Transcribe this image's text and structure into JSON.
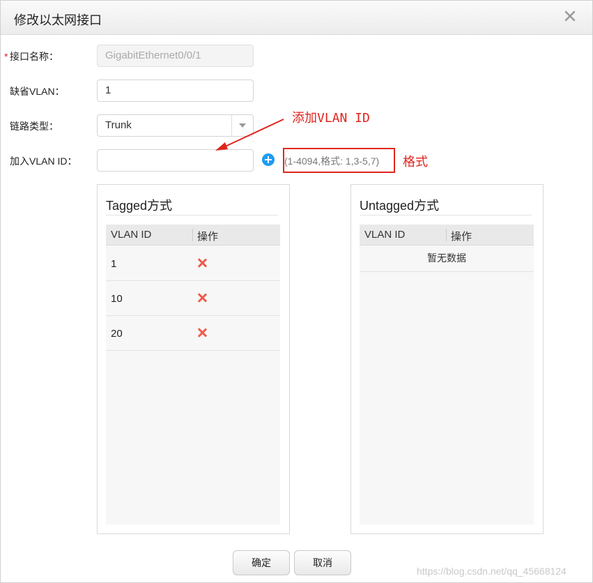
{
  "dialog": {
    "title": "修改以太网接口"
  },
  "form": {
    "interface_name": {
      "label": "接口名称：",
      "required_mark": "*",
      "value": "GigabitEthernet0/0/1"
    },
    "default_vlan": {
      "label": "缺省VLAN：",
      "value": "1"
    },
    "link_type": {
      "label": "链路类型：",
      "value": "Trunk"
    },
    "add_vlan": {
      "label": "加入VLAN ID：",
      "value": "",
      "hint": "(1-4094,格式: 1,3-5,7)"
    }
  },
  "annotations": {
    "add_vlan_id": "添加VLAN ID",
    "format": "格式"
  },
  "tagged": {
    "title": "Tagged方式",
    "columns": [
      "VLAN ID",
      "操作"
    ],
    "rows": [
      "1",
      "10",
      "20"
    ]
  },
  "untagged": {
    "title": "Untagged方式",
    "columns": [
      "VLAN ID",
      "操作"
    ],
    "empty_text": "暂无数据"
  },
  "footer": {
    "confirm_label": "确定",
    "cancel_label": "取消"
  },
  "watermark": "https://blog.csdn.net/qq_45668124",
  "colors": {
    "annotation": "#e0261e",
    "add_icon": "#1e9cf0",
    "delete_icon": "#f05a4a"
  },
  "icons": {
    "close": "close-icon",
    "add": "plus-circle-icon",
    "delete": "delete-x-icon",
    "dropdown": "chevron-down-icon"
  }
}
